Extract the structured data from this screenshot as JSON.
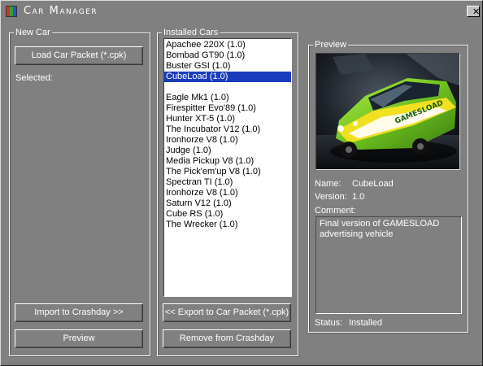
{
  "window": {
    "title": "Car Manager",
    "close_glyph": "✕"
  },
  "new_car": {
    "group_label": "New Car",
    "load_button": "Load Car Packet (*.cpk)",
    "selected_label": "Selected:",
    "import_button": "Import to Crashday >>",
    "preview_button": "Preview"
  },
  "installed": {
    "group_label": "Installed Cars",
    "selected_index": 3,
    "items": [
      "Apachee 220X (1.0)",
      "Bombad GT90 (1.0)",
      "Buster GSI (1.0)",
      "CubeLoad (1.0)",
      "",
      "Eagle Mk1 (1.0)",
      "Firespitter Evo'89 (1.0)",
      "Hunter XT-5 (1.0)",
      "The Incubator V12 (1.0)",
      "Ironhorze V8 (1.0)",
      "Judge (1.0)",
      "Media Pickup V8 (1.0)",
      "The Pick'em'up V8 (1.0)",
      "Spectran TI (1.0)",
      "Ironhorze V8 (1.0)",
      "Saturn V12 (1.0)",
      "Cube RS (1.0)",
      "The Wrecker (1.0)"
    ],
    "export_button": "<< Export to Car Packet (*.cpk)",
    "remove_button": "Remove from Crashday"
  },
  "preview": {
    "group_label": "Preview",
    "image_alt": "GAMESLOAD car",
    "name_label": "Name:",
    "name_value": "CubeLoad",
    "version_label": "Version:",
    "version_value": "1.0",
    "comment_label": "Comment:",
    "comment_value": "Final version of GAMESLOAD advertising vehicle",
    "status_label": "Status:",
    "status_value": "Installed",
    "car_decal": "GAMESLOAD"
  },
  "colors": {
    "background": "#808080",
    "selection": "#1a3cbd",
    "car_green": "#7ed321",
    "car_yellow": "#f0e020"
  }
}
